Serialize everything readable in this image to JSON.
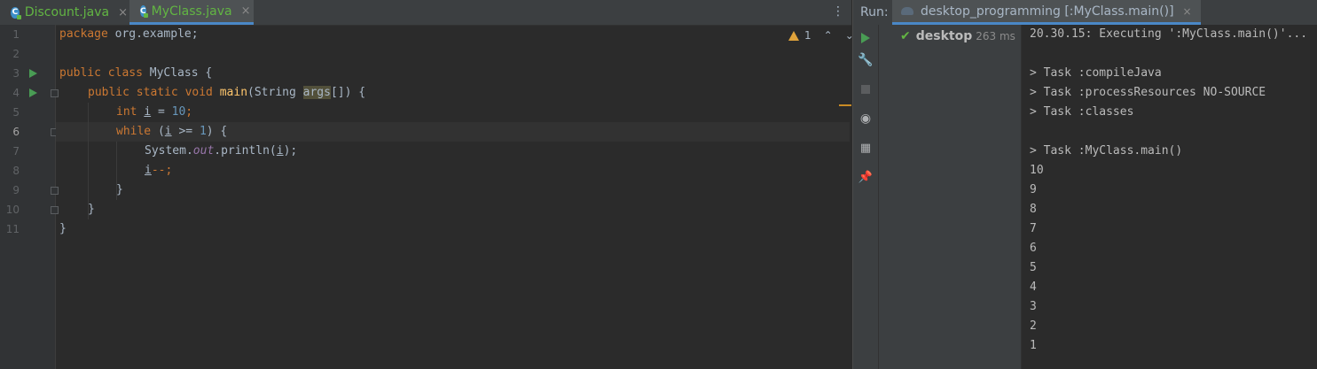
{
  "tabs": [
    {
      "label": "Discount.java",
      "close": "×"
    },
    {
      "label": "MyClass.java",
      "close": "×"
    }
  ],
  "tab_menu": "⋮",
  "editor": {
    "warning_count": "1",
    "line_numbers": [
      "1",
      "2",
      "3",
      "4",
      "5",
      "6",
      "7",
      "8",
      "9",
      "10",
      "11"
    ],
    "lines": {
      "l1_a": "package",
      "l1_b": " org.example;",
      "l3_a": "public class",
      "l3_b": " MyClass {",
      "l4_a": "public static void ",
      "l4_fn": "main",
      "l4_b": "(String ",
      "l4_args": "args",
      "l4_c": "[]) {",
      "l5_kw": "int ",
      "l5_var": "i",
      "l5_b": " = ",
      "l5_num": "10",
      "l5_c": ";",
      "l6_kw": "while ",
      "l6_b": "(",
      "l6_var": "i",
      "l6_c": " >= ",
      "l6_num": "1",
      "l6_d": ") {",
      "l7_a": "System.",
      "l7_fld": "out",
      "l7_b": ".println(",
      "l7_var": "i",
      "l7_c": ");",
      "l8_var": "i",
      "l8_b": "--;",
      "l9": "}",
      "l10": "}",
      "l11": "}"
    }
  },
  "run": {
    "label": "Run:",
    "tab_label": "desktop_programming [:MyClass.main()]",
    "tab_close": "×",
    "tree_item": {
      "name": "desktop",
      "time": "263 ms"
    },
    "console": [
      "20.30.15: Executing ':MyClass.main()'...",
      "",
      "> Task :compileJava",
      "> Task :processResources NO-SOURCE",
      "> Task :classes",
      "",
      "> Task :MyClass.main()",
      "10",
      "9",
      "8",
      "7",
      "6",
      "5",
      "4",
      "3",
      "2",
      "1"
    ]
  },
  "colors": {
    "keyword": "#cc7832",
    "function": "#ffc66d",
    "number": "#6897bb",
    "field": "#9876aa",
    "run_green": "#499c54",
    "accent": "#4a88c7"
  }
}
